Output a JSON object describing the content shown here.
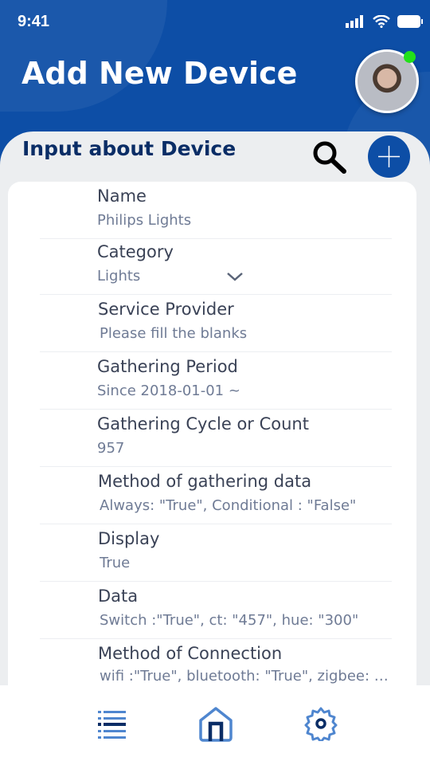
{
  "status": {
    "time": "9:41"
  },
  "header": {
    "title": "Add New Device"
  },
  "section": {
    "title": "Input about Device"
  },
  "fields": [
    {
      "label": "Name",
      "value": "Philips Lights"
    },
    {
      "label": "Category",
      "value": "Lights"
    },
    {
      "label": "Service Provider",
      "value": "Please fill the blanks"
    },
    {
      "label": "Gathering Period",
      "value": "Since 2018-01-01 ~"
    },
    {
      "label": "Gathering Cycle or Count",
      "value": "957"
    },
    {
      "label": "Method of gathering data",
      "value": "Always: \"True\", Conditional : \"False\""
    },
    {
      "label": "Display",
      "value": "True"
    },
    {
      "label": "Data",
      "value": "Switch :\"True\", ct: \"457\", hue: \"300\""
    },
    {
      "label": "Method of Connection",
      "value": "wifi :\"True\", bluetooth: \"True\", zigbee: \"False\""
    }
  ],
  "colors": {
    "primary": "#0d4ea6",
    "navy": "#0a2d66",
    "online": "#22e01a"
  }
}
